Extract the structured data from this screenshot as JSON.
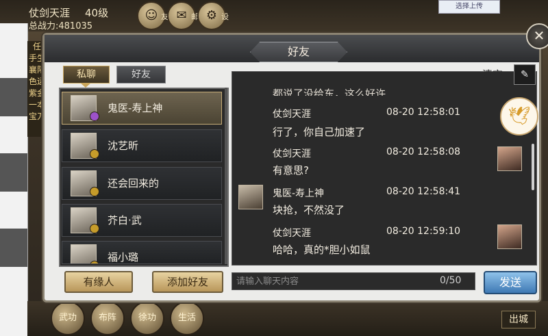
{
  "player": {
    "name": "仗剑天涯",
    "level": "40级",
    "power": "总战力:481035"
  },
  "top_icons": [
    {
      "label": "友",
      "icon": "friends-icon"
    },
    {
      "label": "邮",
      "icon": "mail-icon"
    },
    {
      "label": "设",
      "icon": "settings-icon"
    }
  ],
  "shop_label": "选择上传",
  "side_labels": [
    "任",
    "手生",
    "襄阳",
    "色运",
    "紫金",
    "一本",
    "宝刀"
  ],
  "dialog": {
    "title": "好友",
    "tabs": {
      "private": "私聊",
      "friends": "好友"
    },
    "clear_label": "清空",
    "friends": [
      {
        "name": "鬼医-寿上神",
        "selected": true
      },
      {
        "name": "沈艺昕",
        "selected": false
      },
      {
        "name": "还会回来的",
        "selected": false
      },
      {
        "name": "芥白·武",
        "selected": false
      },
      {
        "name": "福小璐",
        "selected": false
      }
    ],
    "buttons": {
      "fate": "有缘人",
      "add_friend": "添加好友",
      "send": "发送"
    },
    "input_placeholder": "请输入聊天内容",
    "char_count": "0/50",
    "partial_text": "都说了没给东，这么好许",
    "messages": [
      {
        "sender": "仗剑天涯",
        "time": "08-20 12:58:01",
        "text": "行了，你自己加速了",
        "side": "right"
      },
      {
        "sender": "仗剑天涯",
        "time": "08-20 12:58:08",
        "text": "有意思?",
        "side": "right"
      },
      {
        "sender": "鬼医-寿上神",
        "time": "08-20 12:58:41",
        "text": "块抢，不然没了",
        "side": "left"
      },
      {
        "sender": "仗剑天涯",
        "time": "08-20 12:59:10",
        "text": "哈哈，真的*胆小如鼠",
        "side": "right"
      }
    ]
  },
  "bottom_icons": [
    "武功",
    "布阵",
    "徐功",
    "生活"
  ],
  "exit_city": "出城"
}
